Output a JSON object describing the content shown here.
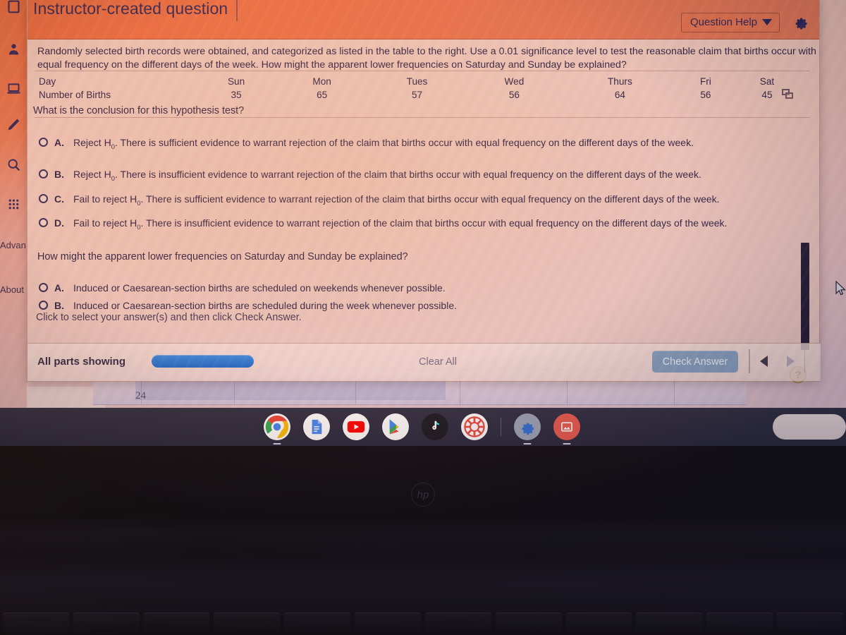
{
  "modal": {
    "title": "Instructor-created question",
    "question_help_label": "Question Help",
    "gear_icon": "gear-icon",
    "caret_icon": "chevron-down-icon",
    "copy_icon": "copy-icon",
    "stem": "Randomly selected birth records were obtained, and categorized as listed in the table to the right. Use a 0.01 significance level to test the reasonable claim that births occur with equal frequency on the different days of the week. How might the apparent lower frequencies on Saturday and Sunday be explained?",
    "table": {
      "row_labels": [
        "Day",
        "Number of Births"
      ],
      "days": [
        "Sun",
        "Mon",
        "Tues",
        "Wed",
        "Thurs",
        "Fri",
        "Sat"
      ],
      "births": [
        "35",
        "65",
        "57",
        "56",
        "64",
        "56",
        "45"
      ]
    },
    "part1": {
      "prompt": "What is the conclusion for this hypothesis test?",
      "options": [
        {
          "letter": "A.",
          "head": "Reject H",
          "sub": "0",
          "tail": ". There is sufficient evidence to warrant rejection of the claim that births occur with equal frequency on the different days of the week."
        },
        {
          "letter": "B.",
          "head": "Reject H",
          "sub": "0",
          "tail": ". There is insufficient evidence to warrant rejection of the claim that births occur with equal frequency on the different days of the week."
        },
        {
          "letter": "C.",
          "head": "Fail to reject H",
          "sub": "0",
          "tail": ". There is sufficient evidence to warrant rejection of the claim that births occur with equal frequency on the different days of the week."
        },
        {
          "letter": "D.",
          "head": "Fail to reject H",
          "sub": "0",
          "tail": ". There is insufficient evidence to warrant rejection of the claim that births occur with equal frequency on the different days of the week."
        }
      ]
    },
    "part2": {
      "prompt": "How might the apparent lower frequencies on Saturday and Sunday be explained?",
      "options": [
        {
          "letter": "A.",
          "text": "Induced or Caesarean-section births are scheduled on weekends whenever possible."
        },
        {
          "letter": "B.",
          "text": "Induced or Caesarean-section births are scheduled during the week whenever possible."
        }
      ]
    },
    "hint": "Click to select your answer(s) and then click Check Answer.",
    "help_bubble": "?",
    "footer": {
      "all_parts_label": "All parts showing",
      "clear_all_label": "Clear All",
      "check_answer_label": "Check Answer",
      "prev_icon": "triangle-left-icon",
      "next_icon": "triangle-right-icon"
    }
  },
  "rail": {
    "icons": [
      {
        "name": "book-icon"
      },
      {
        "name": "person-icon"
      },
      {
        "name": "laptop-icon"
      },
      {
        "name": "pencil-icon"
      },
      {
        "name": "search-icon"
      },
      {
        "name": "apps-grid-icon"
      }
    ],
    "labels": [
      "Advan",
      "About"
    ]
  },
  "background": {
    "table_cell_value": "24"
  },
  "shelf": {
    "apps": [
      {
        "name": "chrome-icon",
        "label": "Chrome"
      },
      {
        "name": "google-docs-icon",
        "label": "Docs"
      },
      {
        "name": "youtube-icon",
        "label": "YouTube"
      },
      {
        "name": "play-store-icon",
        "label": "Play Store"
      },
      {
        "name": "tiktok-icon",
        "label": "TikTok"
      },
      {
        "name": "poker-chip-icon",
        "label": "Game"
      },
      {
        "name": "settings-icon",
        "label": "Settings"
      },
      {
        "name": "gallery-icon",
        "label": "Gallery"
      }
    ],
    "tray": {
      "line1": "",
      "line2": ""
    }
  },
  "device": {
    "brand": "hp"
  },
  "colors": {
    "header_orange": "#e8693d",
    "accent_blue": "#1565c8",
    "check_button": "#7e9cbd",
    "text_navy": "#231c3f",
    "shelf": "#2b2c40"
  }
}
